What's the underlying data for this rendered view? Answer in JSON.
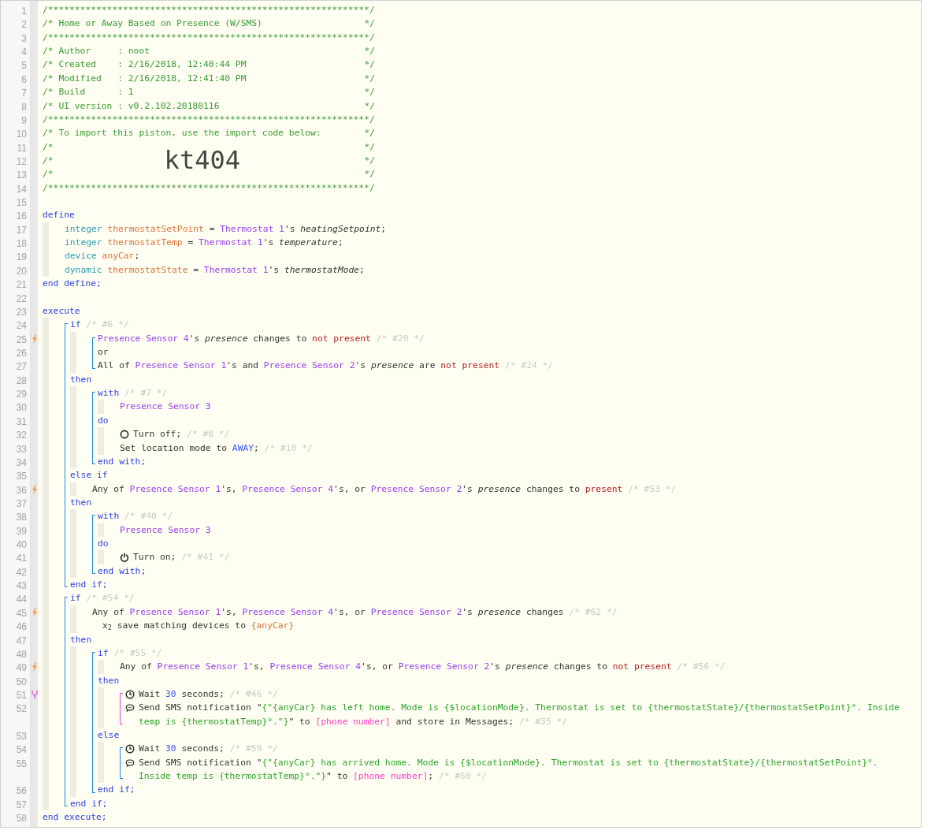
{
  "listing": [
    {
      "kind": "banner",
      "number": "1",
      "tokens": [
        {
          "text": "/************************************************************/",
          "kind": "header"
        }
      ]
    },
    {
      "kind": "banner",
      "number": "2",
      "tokens": [
        {
          "text": "/* Home or Away Based on Presence (W/SMS)",
          "kind": "header"
        },
        {
          "text": "*/",
          "kind": "header"
        }
      ]
    },
    {
      "kind": "banner",
      "number": "3",
      "tokens": [
        {
          "text": "/************************************************************/",
          "kind": "header"
        }
      ]
    },
    {
      "kind": "banner",
      "number": "4",
      "tokens": [
        {
          "text": "/* Author     : noot",
          "kind": "header"
        },
        {
          "text": "*/",
          "kind": "header"
        }
      ]
    },
    {
      "kind": "banner",
      "number": "5",
      "tokens": [
        {
          "text": "/* Created    : 2/16/2018, 12:40:44 PM",
          "kind": "header"
        },
        {
          "text": "*/",
          "kind": "header"
        }
      ]
    },
    {
      "kind": "banner",
      "number": "6",
      "tokens": [
        {
          "text": "/* Modified   : 2/16/2018, 12:41:40 PM",
          "kind": "header"
        },
        {
          "text": "*/",
          "kind": "header"
        }
      ]
    },
    {
      "kind": "banner",
      "number": "7",
      "tokens": [
        {
          "text": "/* Build      : 1",
          "kind": "header"
        },
        {
          "text": "*/",
          "kind": "header"
        }
      ]
    },
    {
      "kind": "banner",
      "number": "8",
      "tokens": [
        {
          "text": "/* UI version : v0.2.102.20180116",
          "kind": "header"
        },
        {
          "text": "*/",
          "kind": "header"
        }
      ]
    },
    {
      "kind": "banner",
      "number": "9",
      "tokens": [
        {
          "text": "/************************************************************/",
          "kind": "header"
        }
      ]
    },
    {
      "kind": "banner",
      "number": "10",
      "tokens": [
        {
          "text": "/* To import this piston, use the import code below:",
          "kind": "header"
        },
        {
          "text": "*/",
          "kind": "header"
        }
      ]
    },
    {
      "kind": "banner",
      "number": "11",
      "tokens": [
        {
          "text": "/*",
          "kind": "header"
        },
        {
          "text": "*/",
          "kind": "header"
        }
      ]
    },
    {
      "kind": "banner",
      "number": "12",
      "tokens": [
        {
          "text": "/*",
          "kind": "header"
        },
        {
          "text": "kt404",
          "kind": "import_code"
        },
        {
          "text": "*/",
          "kind": "header"
        }
      ]
    },
    {
      "kind": "banner",
      "number": "13",
      "tokens": [
        {
          "text": "/*",
          "kind": "header"
        },
        {
          "text": "*/",
          "kind": "header"
        }
      ]
    },
    {
      "kind": "banner",
      "number": "14",
      "tokens": [
        {
          "text": "/************************************************************/",
          "kind": "header"
        }
      ]
    },
    {
      "kind": "code",
      "number": "15"
    },
    {
      "kind": "code",
      "number": "16",
      "tokens": [
        {
          "text": "define",
          "kind": "keyword"
        }
      ]
    },
    {
      "kind": "indent",
      "children": [
        {
          "kind": "code",
          "number": "17",
          "tokens": [
            {
              "text": "integer ",
              "kind": "type"
            },
            {
              "text": "thermostatSetPoint",
              "kind": "variable"
            },
            {
              "text": " = ",
              "kind": "plain"
            },
            {
              "text": "Thermostat 1",
              "kind": "device"
            },
            {
              "text": "'s ",
              "kind": "plain"
            },
            {
              "text": "heatingSetpoint",
              "kind": "attribute"
            },
            {
              "text": ";",
              "kind": "plain"
            }
          ]
        },
        {
          "kind": "code",
          "number": "18",
          "tokens": [
            {
              "text": "integer ",
              "kind": "type"
            },
            {
              "text": "thermostatTemp",
              "kind": "variable"
            },
            {
              "text": " = ",
              "kind": "plain"
            },
            {
              "text": "Thermostat 1",
              "kind": "device"
            },
            {
              "text": "'s ",
              "kind": "plain"
            },
            {
              "text": "temperature",
              "kind": "attribute"
            },
            {
              "text": ";",
              "kind": "plain"
            }
          ]
        },
        {
          "kind": "code",
          "number": "19",
          "tokens": [
            {
              "text": "device ",
              "kind": "type"
            },
            {
              "text": "anyCar",
              "kind": "variable"
            },
            {
              "text": ";",
              "kind": "plain"
            }
          ]
        },
        {
          "kind": "code",
          "number": "20",
          "tokens": [
            {
              "text": "dynamic ",
              "kind": "type"
            },
            {
              "text": "thermostatState",
              "kind": "variable"
            },
            {
              "text": " = ",
              "kind": "plain"
            },
            {
              "text": "Thermostat 1",
              "kind": "device"
            },
            {
              "text": "'s ",
              "kind": "plain"
            },
            {
              "text": "thermostatMode",
              "kind": "attribute"
            },
            {
              "text": ";",
              "kind": "plain"
            }
          ]
        }
      ]
    },
    {
      "kind": "code",
      "number": "21",
      "tokens": [
        {
          "text": "end define;",
          "kind": "keyword"
        }
      ]
    },
    {
      "kind": "code",
      "number": "22"
    },
    {
      "kind": "code",
      "number": "23",
      "tokens": [
        {
          "text": "execute",
          "kind": "keyword"
        }
      ]
    },
    {
      "kind": "indent",
      "children": [
        {
          "kind": "block",
          "color": "#1e88e5",
          "children": [
            {
              "kind": "code",
              "number": "24",
              "tokens": [
                {
                  "text": "if ",
                  "kind": "keyword"
                },
                {
                  "text": "/* #6 */",
                  "kind": "comment"
                }
              ]
            },
            {
              "kind": "indent",
              "children": [
                {
                  "kind": "block",
                  "color": "#1e88e5",
                  "children": [
                    {
                      "kind": "code",
                      "number": "25",
                      "trigger": true,
                      "tokens": [
                        {
                          "text": "Presence Sensor 4",
                          "kind": "device"
                        },
                        {
                          "text": "'s ",
                          "kind": "plain"
                        },
                        {
                          "text": "presence",
                          "kind": "attribute"
                        },
                        {
                          "text": " changes to ",
                          "kind": "plain"
                        },
                        {
                          "text": "not present",
                          "kind": "value"
                        },
                        {
                          "text": " /* #20 */",
                          "kind": "comment"
                        }
                      ]
                    },
                    {
                      "kind": "code",
                      "number": "26",
                      "tokens": [
                        {
                          "text": "or",
                          "kind": "plain"
                        }
                      ]
                    },
                    {
                      "kind": "code",
                      "number": "27",
                      "tokens": [
                        {
                          "text": "All of ",
                          "kind": "plain"
                        },
                        {
                          "text": "Presence Sensor 1",
                          "kind": "device"
                        },
                        {
                          "text": "'s and ",
                          "kind": "plain"
                        },
                        {
                          "text": "Presence Sensor 2",
                          "kind": "device"
                        },
                        {
                          "text": "'s ",
                          "kind": "plain"
                        },
                        {
                          "text": "presence",
                          "kind": "attribute"
                        },
                        {
                          "text": " are ",
                          "kind": "plain"
                        },
                        {
                          "text": "not present",
                          "kind": "value"
                        },
                        {
                          "text": " /* #24 */",
                          "kind": "comment"
                        }
                      ]
                    }
                  ]
                }
              ]
            },
            {
              "kind": "code",
              "number": "28",
              "tokens": [
                {
                  "text": "then",
                  "kind": "keyword"
                }
              ]
            },
            {
              "kind": "indent",
              "children": [
                {
                  "kind": "block",
                  "color": "#1e88e5",
                  "children": [
                    {
                      "kind": "code",
                      "number": "29",
                      "tokens": [
                        {
                          "text": "with ",
                          "kind": "keyword"
                        },
                        {
                          "text": "/* #7 */",
                          "kind": "comment"
                        }
                      ]
                    },
                    {
                      "kind": "indent",
                      "children": [
                        {
                          "kind": "code",
                          "number": "30",
                          "tokens": [
                            {
                              "text": "Presence Sensor 3",
                              "kind": "device"
                            }
                          ]
                        }
                      ]
                    },
                    {
                      "kind": "code",
                      "number": "31",
                      "tokens": [
                        {
                          "text": "do",
                          "kind": "keyword"
                        }
                      ]
                    },
                    {
                      "kind": "indent",
                      "children": [
                        {
                          "kind": "turn_off",
                          "number": "32",
                          "tokens": [
                            {
                              "text": "Turn off; ",
                              "kind": "plain"
                            },
                            {
                              "text": "/* #8 */",
                              "kind": "comment"
                            }
                          ]
                        },
                        {
                          "kind": "code",
                          "number": "33",
                          "tokens": [
                            {
                              "text": "Set location mode to ",
                              "kind": "plain"
                            },
                            {
                              "text": "AWAY",
                              "kind": "constant"
                            },
                            {
                              "text": "; ",
                              "kind": "plain"
                            },
                            {
                              "text": "/* #10 */",
                              "kind": "comment"
                            }
                          ]
                        }
                      ]
                    },
                    {
                      "kind": "code",
                      "number": "34",
                      "tokens": [
                        {
                          "text": "end with;",
                          "kind": "keyword"
                        }
                      ]
                    }
                  ]
                }
              ]
            },
            {
              "kind": "code",
              "number": "35",
              "tokens": [
                {
                  "text": "else if",
                  "kind": "keyword"
                }
              ]
            },
            {
              "kind": "indent",
              "children": [
                {
                  "kind": "code",
                  "number": "36",
                  "trigger": true,
                  "tokens": [
                    {
                      "text": "Any of ",
                      "kind": "plain"
                    },
                    {
                      "text": "Presence Sensor 1",
                      "kind": "device"
                    },
                    {
                      "text": "'s, ",
                      "kind": "plain"
                    },
                    {
                      "text": "Presence Sensor 4",
                      "kind": "device"
                    },
                    {
                      "text": "'s, or ",
                      "kind": "plain"
                    },
                    {
                      "text": "Presence Sensor 2",
                      "kind": "device"
                    },
                    {
                      "text": "'s ",
                      "kind": "plain"
                    },
                    {
                      "text": "presence",
                      "kind": "attribute"
                    },
                    {
                      "text": " changes to ",
                      "kind": "plain"
                    },
                    {
                      "text": "present",
                      "kind": "value"
                    },
                    {
                      "text": " /* #53 */",
                      "kind": "comment"
                    }
                  ]
                }
              ]
            },
            {
              "kind": "code",
              "number": "37",
              "tokens": [
                {
                  "text": "then",
                  "kind": "keyword"
                }
              ]
            },
            {
              "kind": "indent",
              "children": [
                {
                  "kind": "block",
                  "color": "#1e88e5",
                  "children": [
                    {
                      "kind": "code",
                      "number": "38",
                      "tokens": [
                        {
                          "text": "with ",
                          "kind": "keyword"
                        },
                        {
                          "text": "/* #40 */",
                          "kind": "comment"
                        }
                      ]
                    },
                    {
                      "kind": "indent",
                      "children": [
                        {
                          "kind": "code",
                          "number": "39",
                          "tokens": [
                            {
                              "text": "Presence Sensor 3",
                              "kind": "device"
                            }
                          ]
                        }
                      ]
                    },
                    {
                      "kind": "code",
                      "number": "40",
                      "tokens": [
                        {
                          "text": "do",
                          "kind": "keyword"
                        }
                      ]
                    },
                    {
                      "kind": "indent",
                      "children": [
                        {
                          "kind": "turn_on",
                          "number": "41",
                          "tokens": [
                            {
                              "text": "Turn on; ",
                              "kind": "plain"
                            },
                            {
                              "text": "/* #41 */",
                              "kind": "comment"
                            }
                          ]
                        }
                      ]
                    },
                    {
                      "kind": "code",
                      "number": "42",
                      "tokens": [
                        {
                          "text": "end with;",
                          "kind": "keyword"
                        }
                      ]
                    }
                  ]
                }
              ]
            },
            {
              "kind": "code",
              "number": "43",
              "tokens": [
                {
                  "text": "end if;",
                  "kind": "keyword"
                }
              ]
            }
          ]
        },
        {
          "kind": "block",
          "color": "#1e88e5",
          "children": [
            {
              "kind": "code",
              "number": "44",
              "tokens": [
                {
                  "text": "if ",
                  "kind": "keyword"
                },
                {
                  "text": "/* #54 */",
                  "kind": "comment"
                }
              ]
            },
            {
              "kind": "indent",
              "children": [
                {
                  "kind": "code",
                  "number": "45",
                  "trigger": true,
                  "tokens": [
                    {
                      "text": "Any of ",
                      "kind": "plain"
                    },
                    {
                      "text": "Presence Sensor 1",
                      "kind": "device"
                    },
                    {
                      "text": "'s, ",
                      "kind": "plain"
                    },
                    {
                      "text": "Presence Sensor 4",
                      "kind": "device"
                    },
                    {
                      "text": "'s, or ",
                      "kind": "plain"
                    },
                    {
                      "text": "Presence Sensor 2",
                      "kind": "device"
                    },
                    {
                      "text": "'s ",
                      "kind": "plain"
                    },
                    {
                      "text": "presence",
                      "kind": "attribute"
                    },
                    {
                      "text": " changes ",
                      "kind": "plain"
                    },
                    {
                      "text": "/* #62 */",
                      "kind": "comment"
                    }
                  ]
                },
                {
                  "kind": "option",
                  "number": "46",
                  "tokens": [
                    {
                      "text": "x$_{2}$ save matching devices to ",
                      "kind": "plain"
                    },
                    {
                      "text": "{anyCar}",
                      "kind": "variable"
                    }
                  ]
                }
              ]
            },
            {
              "kind": "code",
              "number": "47",
              "tokens": [
                {
                  "text": "then",
                  "kind": "keyword"
                }
              ]
            },
            {
              "kind": "indent",
              "children": [
                {
                  "kind": "block",
                  "color": "#1e88e5",
                  "children": [
                    {
                      "kind": "code",
                      "number": "48",
                      "tokens": [
                        {
                          "text": "if ",
                          "kind": "keyword"
                        },
                        {
                          "text": "/* #55 */",
                          "kind": "comment"
                        }
                      ]
                    },
                    {
                      "kind": "indent",
                      "children": [
                        {
                          "kind": "code",
                          "number": "49",
                          "trigger": true,
                          "tokens": [
                            {
                              "text": "Any of ",
                              "kind": "plain"
                            },
                            {
                              "text": "Presence Sensor 1",
                              "kind": "device"
                            },
                            {
                              "text": "'s, ",
                              "kind": "plain"
                            },
                            {
                              "text": "Presence Sensor 4",
                              "kind": "device"
                            },
                            {
                              "text": "'s, or ",
                              "kind": "plain"
                            },
                            {
                              "text": "Presence Sensor 2",
                              "kind": "device"
                            },
                            {
                              "text": "'s ",
                              "kind": "plain"
                            },
                            {
                              "text": "presence",
                              "kind": "attribute"
                            },
                            {
                              "text": " changes to ",
                              "kind": "plain"
                            },
                            {
                              "text": "not present",
                              "kind": "value"
                            },
                            {
                              "text": " /* #56 */",
                              "kind": "comment"
                            }
                          ]
                        }
                      ]
                    },
                    {
                      "kind": "code",
                      "number": "50",
                      "tokens": [
                        {
                          "text": "then",
                          "kind": "keyword"
                        }
                      ]
                    },
                    {
                      "kind": "indent",
                      "children": [
                        {
                          "kind": "block",
                          "color": "#e24bd0",
                          "children": [
                            {
                              "kind": "wait",
                              "number": "51",
                              "async": true,
                              "tokens": [
                                {
                                  "text": "Wait ",
                                  "kind": "plain"
                                },
                                {
                                  "text": "30",
                                  "kind": "constant"
                                },
                                {
                                  "text": " seconds; ",
                                  "kind": "plain"
                                },
                                {
                                  "text": "/* #46 */",
                                  "kind": "comment"
                                }
                              ]
                            },
                            {
                              "kind": "notify",
                              "number": "52",
                              "tokens": [
                                {
                                  "text": "Send SMS notification \"",
                                  "kind": "plain"
                                },
                                {
                                  "text": "{\"{anyCar} has left home. Mode is {$locationMode}. Thermostat is set to {thermostatState}/{thermostatSetPoint}°. Inside",
                                  "kind": "string"
                                }
                              ],
                              "continued": [
                                {
                                  "text": "temp is {thermostatTemp}°.\"}",
                                  "kind": "string"
                                },
                                {
                                  "text": "\" to ",
                                  "kind": "plain"
                                },
                                {
                                  "text": "[phone number]",
                                  "kind": "phone"
                                },
                                {
                                  "text": " and store in Messages; ",
                                  "kind": "plain"
                                },
                                {
                                  "text": "/* #35 */",
                                  "kind": "comment"
                                }
                              ]
                            }
                          ]
                        }
                      ]
                    },
                    {
                      "kind": "code",
                      "number": "53",
                      "tokens": [
                        {
                          "text": "else",
                          "kind": "keyword"
                        }
                      ]
                    },
                    {
                      "kind": "indent",
                      "children": [
                        {
                          "kind": "block",
                          "color": "#1e88e5",
                          "children": [
                            {
                              "kind": "wait",
                              "number": "54",
                              "tokens": [
                                {
                                  "text": "Wait ",
                                  "kind": "plain"
                                },
                                {
                                  "text": "30",
                                  "kind": "constant"
                                },
                                {
                                  "text": " seconds; ",
                                  "kind": "plain"
                                },
                                {
                                  "text": "/* #59 */",
                                  "kind": "comment"
                                }
                              ]
                            },
                            {
                              "kind": "notify",
                              "number": "55",
                              "tokens": [
                                {
                                  "text": "Send SMS notification \"",
                                  "kind": "plain"
                                },
                                {
                                  "text": "{\"{anyCar} has arrived home. Mode is {$locationMode}. Thermostat is set to {thermostatState}/{thermostatSetPoint}°.",
                                  "kind": "string"
                                }
                              ],
                              "continued": [
                                {
                                  "text": "Inside temp is {thermostatTemp}°.\"}",
                                  "kind": "string"
                                },
                                {
                                  "text": "\" to ",
                                  "kind": "plain"
                                },
                                {
                                  "text": "[phone number]",
                                  "kind": "phone"
                                },
                                {
                                  "text": "; ",
                                  "kind": "plain"
                                },
                                {
                                  "text": "/* #60 */",
                                  "kind": "comment"
                                }
                              ]
                            }
                          ]
                        }
                      ]
                    },
                    {
                      "kind": "code",
                      "number": "56",
                      "tokens": [
                        {
                          "text": "end if;",
                          "kind": "keyword"
                        }
                      ]
                    }
                  ]
                }
              ]
            },
            {
              "kind": "code",
              "number": "57",
              "tokens": [
                {
                  "text": "end if;",
                  "kind": "keyword"
                }
              ]
            }
          ]
        }
      ]
    },
    {
      "kind": "code",
      "number": "58",
      "tokens": [
        {
          "text": "end execute;",
          "kind": "keyword"
        }
      ]
    }
  ]
}
